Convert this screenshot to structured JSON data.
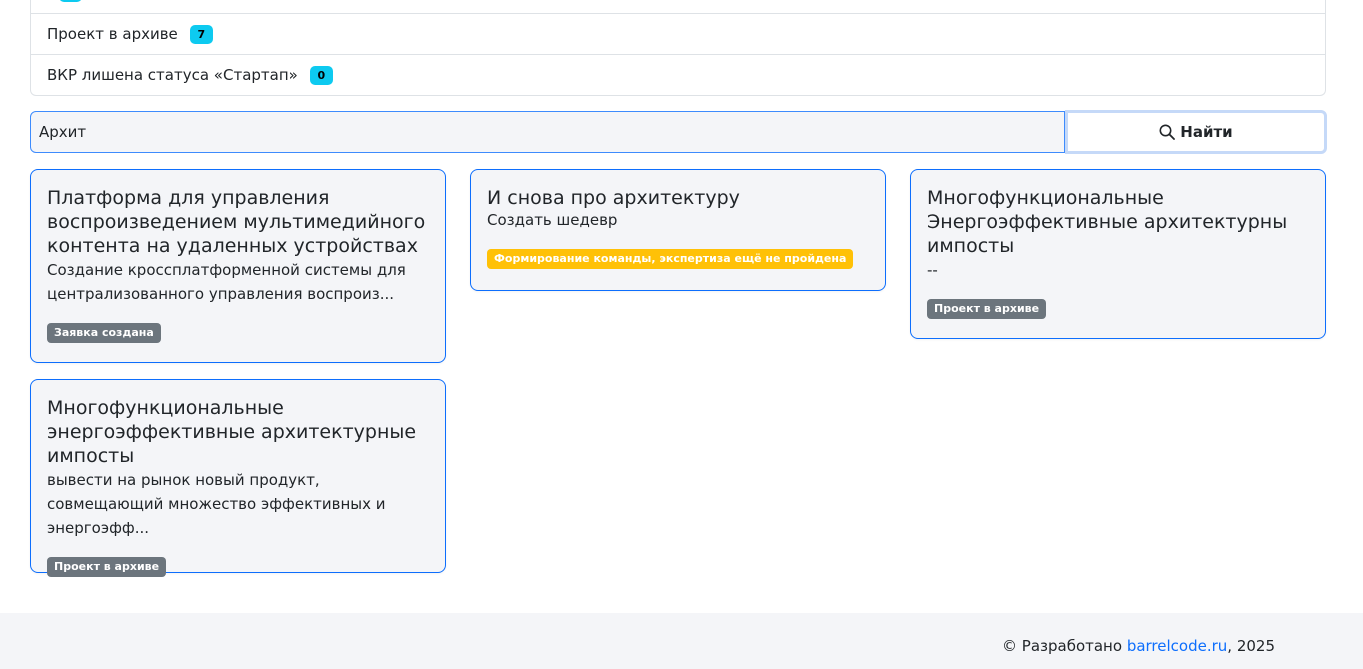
{
  "status_filters": [
    {
      "label": "",
      "count": ""
    },
    {
      "label": "Проект в архиве",
      "count": "7"
    },
    {
      "label": "ВКР лишена статуса «Стартап»",
      "count": "0"
    }
  ],
  "search": {
    "value": "Архит",
    "button_label": "Найти"
  },
  "cards": [
    {
      "title": "Платформа для управления воспроизведением мультимедийного контента на удаленных устройствах",
      "description": "Создание кроссплатформенной системы для централизованного управления воспроиз...",
      "status": "Заявка создана"
    },
    {
      "title": "И снова про архитектуру",
      "description": "Создать шедевр",
      "status": "Формирование команды, экспертиза ещё не пройдена"
    },
    {
      "title": "Многофункциональные Энергоэффективные архитектурны импосты",
      "description": "--",
      "status": "Проект в архиве"
    },
    {
      "title": "Многофункциональные энергоэффективные архитектурные импосты",
      "description": "вывести на рынок новый продукт, совмещающий множество эффективных и энергоэфф...",
      "status": "Проект в архиве"
    }
  ],
  "footer": {
    "prefix": "© Разработано ",
    "link_text": "barrelcode.ru",
    "suffix": ", 2025"
  },
  "colors": {
    "accent": "#0d6efd",
    "info_badge": "#0dcaf0",
    "warning_badge": "#ffc107",
    "secondary_badge": "#6c757d"
  }
}
